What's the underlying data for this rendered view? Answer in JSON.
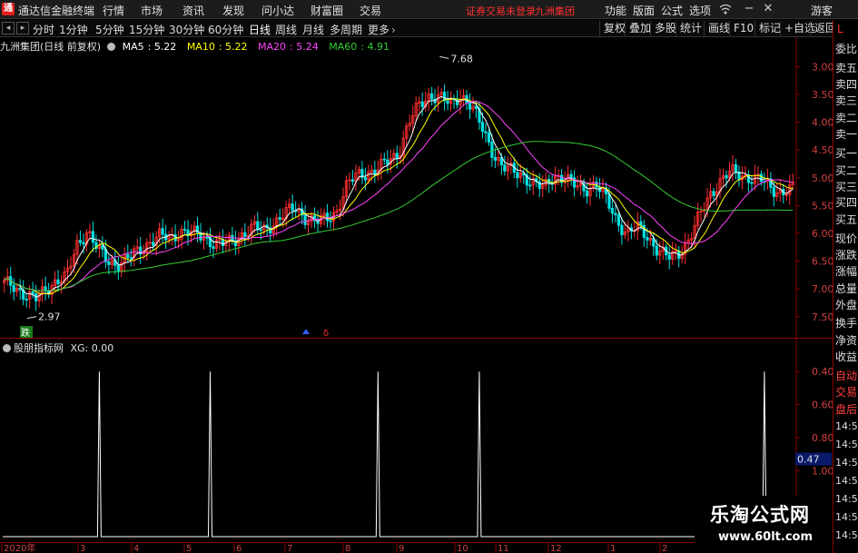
{
  "app": {
    "title": "通达信金融终端",
    "logo": "通",
    "menu": [
      "行情",
      "市场",
      "资讯",
      "发现",
      "问小达",
      "财富圈",
      "交易"
    ],
    "trade_status": "证券交易未登录",
    "stock_name": "九洲集团",
    "right_menu": [
      "功能",
      "版面",
      "公式",
      "选项"
    ],
    "guest": "游客"
  },
  "toolbar": {
    "periods": [
      "分时",
      "1分钟",
      "5分钟",
      "15分钟",
      "30分钟",
      "60分钟",
      "日线",
      "周线",
      "月线",
      "多周期",
      "更多"
    ],
    "active_period": "日线",
    "tools": [
      "复权",
      "叠加",
      "多股",
      "统计",
      "画线",
      "F10",
      "标记",
      "+自选",
      "返回"
    ]
  },
  "main_chart": {
    "stock_label": "九洲集团(日线 前复权)",
    "ma": [
      {
        "name": "MA5",
        "value": "5.22",
        "color": "#ffffff"
      },
      {
        "name": "MA10",
        "value": "5.22",
        "color": "#ffff00"
      },
      {
        "name": "MA20",
        "value": "5.24",
        "color": "#ff44ff"
      },
      {
        "name": "MA60",
        "value": "4.91",
        "color": "#33cc33"
      }
    ],
    "high_label": "7.68",
    "low_label": "2.97",
    "drop_marker": "跌",
    "y_ticks": [
      "7.50",
      "7.00",
      "6.50",
      "6.00",
      "5.50",
      "5.00",
      "4.50",
      "4.00",
      "3.50",
      "3.00"
    ]
  },
  "sub_chart": {
    "indicator": "股朋指标网",
    "value_label": "XG: 0.00",
    "y_ticks": [
      "1.00",
      "0.80",
      "0.60",
      "0.40"
    ],
    "current": "0.47"
  },
  "time_axis": [
    "2020年",
    "3",
    "4",
    "5",
    "6",
    "7",
    "8",
    "9",
    "10",
    "11",
    "12",
    "1",
    "2"
  ],
  "right_panel": {
    "letter": "L",
    "labels": [
      "委比",
      "卖五",
      "卖四",
      "卖三",
      "卖二",
      "卖一",
      "买一",
      "买二",
      "买三",
      "买四",
      "买五",
      "现价",
      "涨跌",
      "涨幅",
      "总量",
      "外盘",
      "换手",
      "净资",
      "收益",
      "自动",
      "交易",
      "盘后"
    ],
    "times": [
      "14:56",
      "14:56",
      "14:56",
      "14:56",
      "14:56",
      "14:56",
      "14:56"
    ]
  },
  "watermark": {
    "text": "乐淘公式网",
    "url": "www.60lt.com"
  },
  "chart_data": [
    {
      "type": "candlestick",
      "title": "九洲集团(日线 前复权)",
      "ylim": [
        2.8,
        7.8
      ],
      "y_ticks": [
        3.0,
        3.5,
        4.0,
        4.5,
        5.0,
        5.5,
        6.0,
        6.5,
        7.0,
        7.5
      ],
      "x_ticks": [
        "2020年",
        "3",
        "4",
        "5",
        "6",
        "7",
        "8",
        "9",
        "10",
        "11",
        "12",
        "1",
        "2"
      ],
      "annotations": [
        {
          "text": "7.68",
          "value": 7.68
        },
        {
          "text": "2.97",
          "value": 2.97
        }
      ],
      "series": [
        {
          "name": "close",
          "values": [
            3.6,
            3.55,
            3.4,
            3.3,
            3.5,
            3.65,
            3.7,
            4.3,
            4.55,
            4.2,
            4.0,
            3.95,
            4.05,
            4.2,
            4.35,
            4.45,
            4.4,
            4.55,
            4.5,
            4.45,
            4.35,
            4.3,
            4.35,
            4.5,
            4.6,
            4.55,
            4.7,
            4.85,
            4.95,
            4.8,
            4.7,
            4.75,
            4.9,
            5.35,
            5.55,
            5.6,
            5.65,
            5.8,
            5.95,
            6.5,
            6.8,
            7.0,
            6.95,
            6.8,
            7.0,
            6.8,
            6.4,
            6.0,
            5.7,
            5.6,
            5.55,
            5.4,
            5.3,
            5.55,
            5.5,
            5.35,
            5.3,
            5.4,
            5.1,
            4.75,
            4.5,
            4.6,
            4.45,
            4.2,
            4.05,
            4.15,
            4.4,
            4.8,
            5.2,
            5.45,
            5.6,
            5.55,
            5.5,
            5.45,
            5.3,
            5.25,
            5.3
          ]
        },
        {
          "name": "MA5",
          "values": [
            5.22
          ]
        },
        {
          "name": "MA10",
          "values": [
            5.22
          ]
        },
        {
          "name": "MA20",
          "values": [
            5.24
          ]
        },
        {
          "name": "MA60",
          "values": [
            4.91
          ]
        }
      ]
    },
    {
      "type": "line",
      "title": "股朋指标网",
      "ylim": [
        0,
        1.1
      ],
      "y_ticks": [
        0.4,
        0.6,
        0.8,
        1.0
      ],
      "series": [
        {
          "name": "XG",
          "spikes_at_bar": [
            12,
            26,
            47,
            60,
            96
          ],
          "spike_value": 1.0
        }
      ]
    }
  ]
}
